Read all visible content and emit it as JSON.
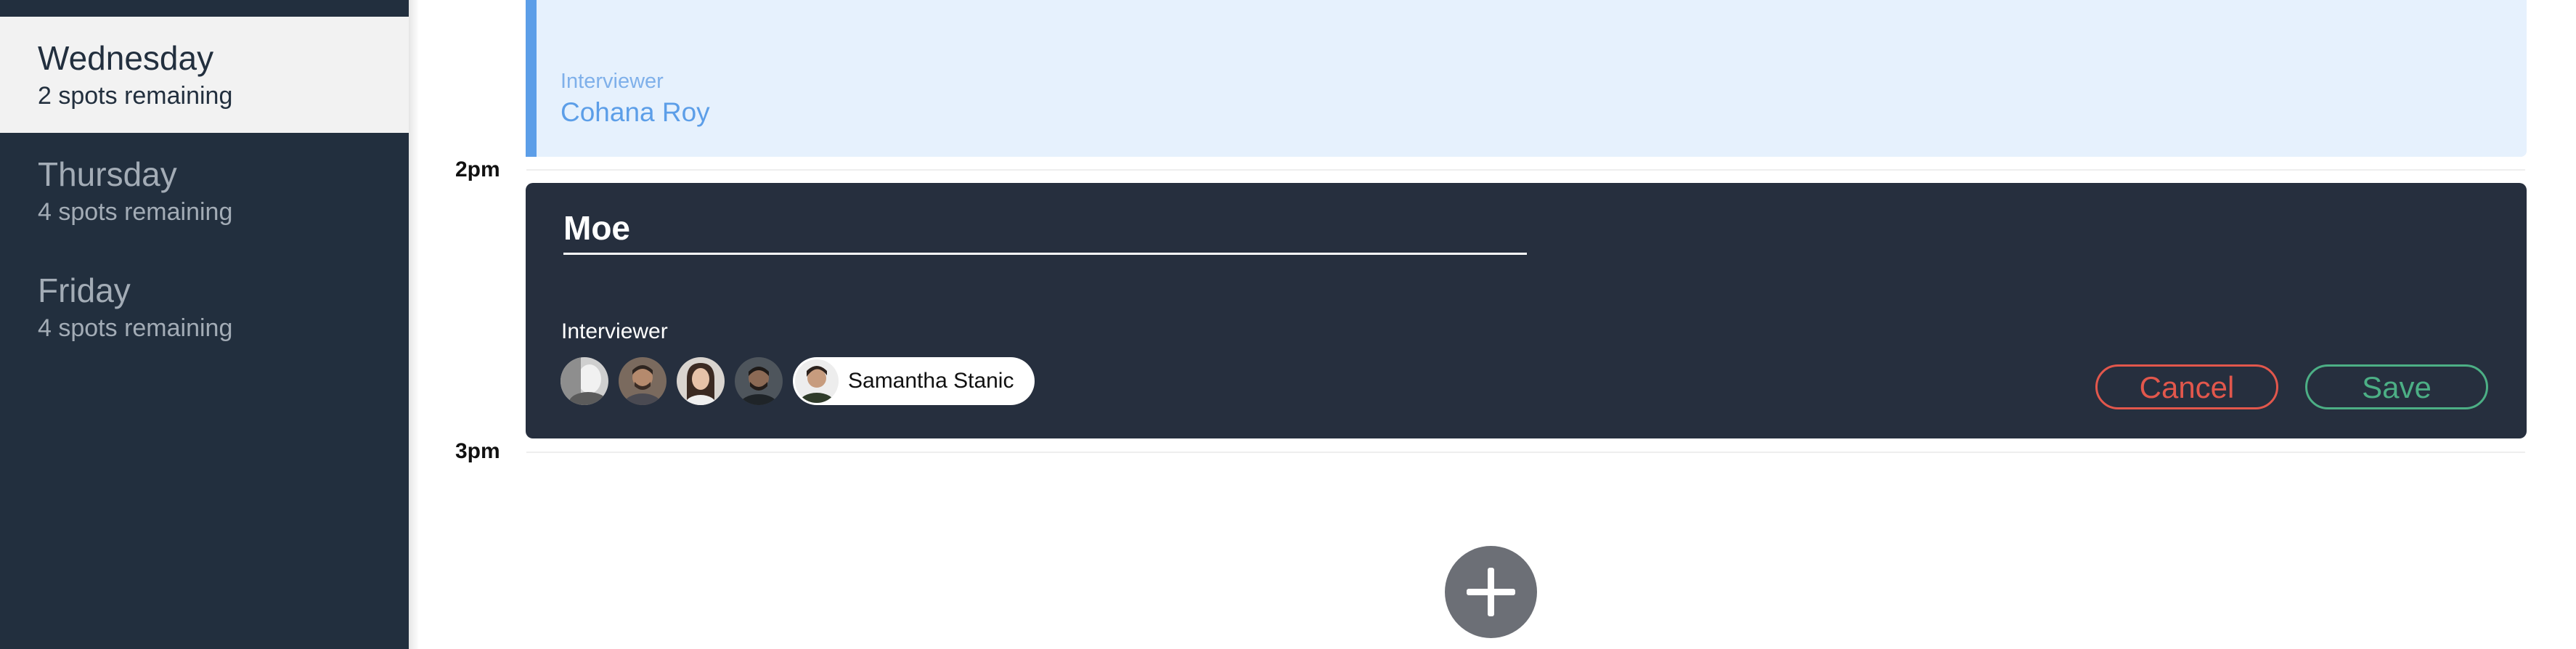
{
  "sidebar": {
    "days": [
      {
        "name": "Wednesday",
        "spots": "2 spots remaining",
        "selected": true
      },
      {
        "name": "Thursday",
        "spots": "4 spots remaining",
        "selected": false
      },
      {
        "name": "Friday",
        "spots": "4 spots remaining",
        "selected": false
      }
    ]
  },
  "schedule": {
    "times": [
      "2pm",
      "3pm"
    ],
    "booked": {
      "interviewer_label": "Interviewer",
      "interviewer_name": "Cohana Roy"
    },
    "form": {
      "student_name_value": "Moe",
      "interviewer_label": "Interviewer",
      "selected_interviewer": "Samantha Stanic",
      "cancel_label": "Cancel",
      "save_label": "Save"
    }
  },
  "colors": {
    "sidebar_bg": "#222f3e",
    "accent_blue": "#5c9ee8",
    "cancel_red": "#e2574c",
    "save_green": "#4caf85",
    "add_button": "#6c6f76"
  },
  "icons": {
    "add": "plus-icon",
    "avatar": "interviewer-avatar"
  }
}
